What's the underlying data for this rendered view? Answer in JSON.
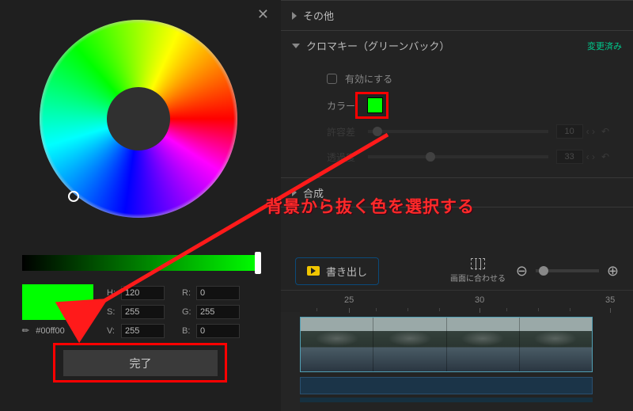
{
  "close_label": "✕",
  "color_fields": {
    "h_label": "H:",
    "h_val": "120",
    "s_label": "S:",
    "s_val": "255",
    "v_label": "V:",
    "v_val": "255",
    "r_label": "R:",
    "r_val": "0",
    "g_label": "G:",
    "g_val": "255",
    "b_label": "B:",
    "b_val": "0"
  },
  "hex_value": "#00ff00",
  "done_label": "完了",
  "sections": {
    "other": "その他",
    "chroma": "クロマキー（グリーンバック）",
    "changed": "変更済み",
    "compose": "合成"
  },
  "chroma": {
    "enable": "有効にする",
    "color_label": "カラー",
    "tolerance_label": "許容差",
    "tolerance_val": "10",
    "transparency_label": "透過度",
    "transparency_val": "33"
  },
  "toolbar": {
    "export": "書き出し",
    "fit": "画面に合わせる",
    "minus": "⊖",
    "plus": "⊕"
  },
  "ruler": {
    "t1": "25",
    "t2": "30",
    "t3": "35"
  },
  "annotation": "背景から抜く色を選択する",
  "icons": {
    "eyedropper": "✎",
    "reset": "↶",
    "arrows": "‹ ›"
  }
}
